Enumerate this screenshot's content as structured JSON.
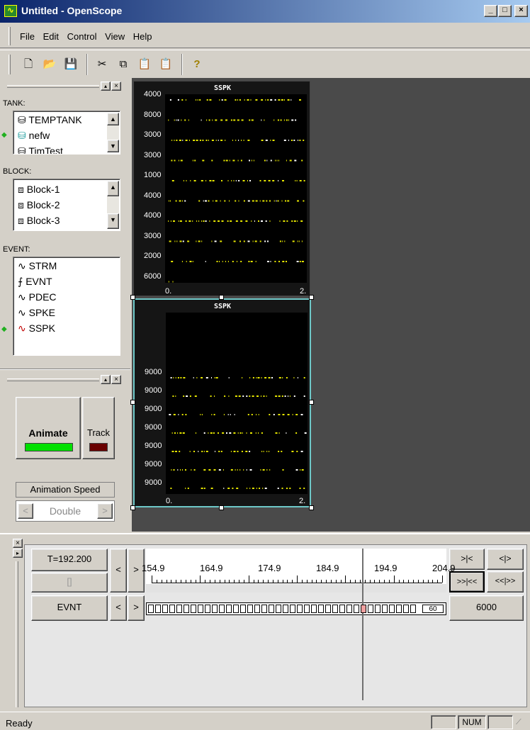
{
  "window": {
    "title": "Untitled - OpenScope",
    "min": "_",
    "max": "□",
    "close": "×"
  },
  "menu": [
    "File",
    "Edit",
    "Control",
    "View",
    "Help"
  ],
  "toolbar": [
    {
      "name": "new-icon",
      "glyph": "🗋"
    },
    {
      "name": "open-icon",
      "glyph": "📂"
    },
    {
      "name": "save-icon",
      "glyph": "💾"
    },
    {
      "name": "cut-icon",
      "glyph": "✂"
    },
    {
      "name": "copy-icon",
      "glyph": "⧉"
    },
    {
      "name": "paste-icon",
      "glyph": "📋"
    },
    {
      "name": "paste-special-icon",
      "glyph": "📋"
    },
    {
      "name": "help-icon",
      "glyph": "?"
    }
  ],
  "left": {
    "tank_label": "TANK:",
    "tanks": [
      "TEMPTANK",
      "nefw",
      "TimTest"
    ],
    "block_label": "BLOCK:",
    "blocks": [
      "Block-1",
      "Block-2",
      "Block-3"
    ],
    "event_label": "EVENT:",
    "events": [
      {
        "label": "STRM",
        "icon": "∿"
      },
      {
        "label": "EVNT",
        "icon": "⨍"
      },
      {
        "label": "PDEC",
        "icon": "∿"
      },
      {
        "label": "SPKE",
        "icon": "∿"
      },
      {
        "label": "SSPK",
        "icon": "∿"
      }
    ],
    "animate": "Animate",
    "track": "Track",
    "speed_label": "Animation Speed",
    "speed_value": "Double"
  },
  "plot1": {
    "title": "SSPK",
    "yticks": [
      "4000",
      "8000",
      "3000",
      "3000",
      "1000",
      "4000",
      "4000",
      "3000",
      "2000",
      "6000"
    ],
    "xmin": "0.",
    "xmax": "2."
  },
  "plot2": {
    "title": "SSPK",
    "yticks": [
      "9000",
      "9000",
      "9000",
      "9000",
      "9000",
      "9000",
      "9000"
    ],
    "xmin": "0.",
    "xmax": "2."
  },
  "bottom": {
    "time": "T=192.200",
    "slot": "[]",
    "event": "EVNT",
    "ticks": [
      "154.9",
      "164.9",
      "174.9",
      "184.9",
      "194.9",
      "204.9"
    ],
    "count": "60",
    "value": "6000",
    "nav1": ">|<",
    "nav2": "<|>",
    "nav3": ">>|<<",
    "nav4": "<<|>>",
    "left": "<",
    "right": ">"
  },
  "status": {
    "text": "Ready",
    "num": "NUM"
  }
}
